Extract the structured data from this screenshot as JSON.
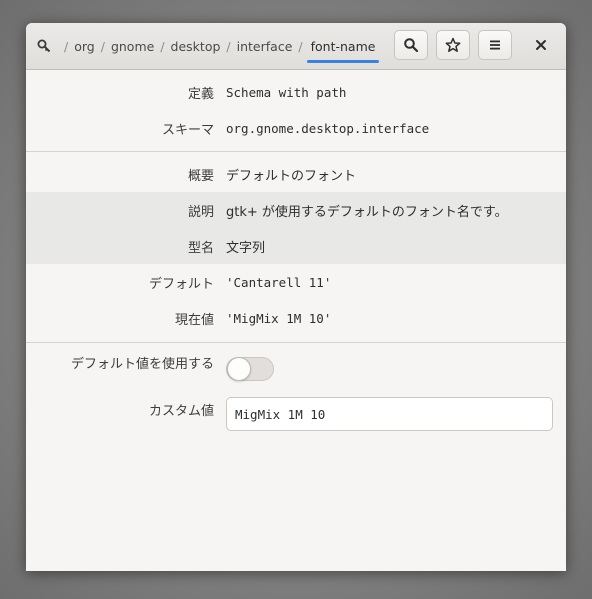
{
  "breadcrumb": {
    "root_icon": "search-key-icon",
    "separator": "/",
    "items": [
      "org",
      "gnome",
      "desktop",
      "interface",
      "font-name"
    ],
    "active": "font-name"
  },
  "header_buttons": {
    "search_icon": "search-icon",
    "bookmark_icon": "star-icon",
    "menu_icon": "hamburger-menu-icon",
    "close_icon": "close-icon"
  },
  "details": {
    "definition_label": "定義",
    "definition_value": "Schema with path",
    "schema_label": "スキーマ",
    "schema_value": "org.gnome.desktop.interface",
    "summary_label": "概要",
    "summary_value": "デフォルトのフォント",
    "description_label": "説明",
    "description_value": "gtk+ が使用するデフォルトのフォント名です。",
    "type_label": "型名",
    "type_value": "文字列",
    "default_label": "デフォルト",
    "default_value": "'Cantarell 11'",
    "current_label": "現在値",
    "current_value": "'MigMix 1M 10'"
  },
  "settings": {
    "use_default_label": "デフォルト値を使用する",
    "use_default_on": false,
    "custom_label": "カスタム値",
    "custom_value": "MigMix 1M 10"
  },
  "colors": {
    "accent": "#3584e4",
    "window_bg": "#f6f5f4",
    "shaded_row": "#e8e8e7"
  }
}
